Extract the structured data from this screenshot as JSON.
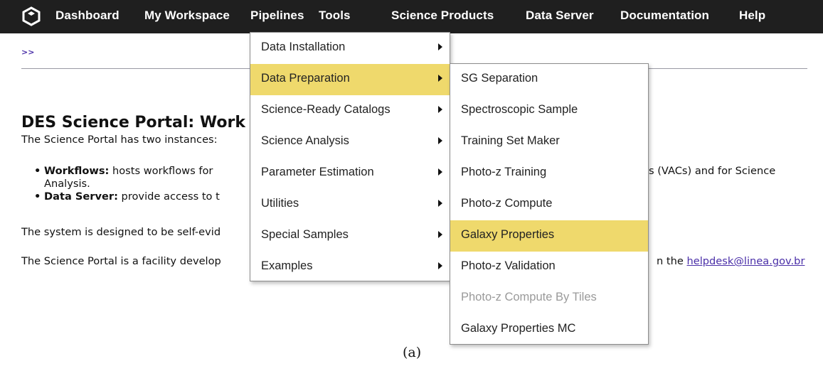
{
  "navbar": {
    "items": [
      "Dashboard",
      "My Workspace",
      "Pipelines",
      "Tools",
      "Science Products",
      "Data Server",
      "Documentation",
      "Help"
    ]
  },
  "breadcrumb": ">>",
  "page": {
    "title": "DES Science Portal: Work",
    "intro": "The Science Portal has two instances:",
    "bullet1_label": "Workflows:",
    "bullet1_text": " hosts workflows for",
    "bullet1_right": "s (VACs) and for Science",
    "bullet1_cont": "Analysis.",
    "bullet2_label": "Data Server:",
    "bullet2_text": " provide access to t",
    "system_line": "The system is designed to be self-evid",
    "facility_line": "The Science Portal is a facility develop",
    "contact_prefix": "n the ",
    "contact_email": "helpdesk@linea.gov.br"
  },
  "pipelines_menu": {
    "items": [
      "Data Installation",
      "Data Preparation",
      "Science-Ready Catalogs",
      "Science Analysis",
      "Parameter Estimation",
      "Utilities",
      "Special Samples",
      "Examples"
    ],
    "highlighted": "Data Preparation"
  },
  "data_prep_menu": {
    "items": [
      "SG Separation",
      "Spectroscopic Sample",
      "Training Set Maker",
      "Photo-z Training",
      "Photo-z Compute",
      "Galaxy Properties",
      "Photo-z Validation",
      "Photo-z Compute By Tiles",
      "Galaxy Properties MC"
    ],
    "highlighted": "Galaxy Properties",
    "disabled": "Photo-z Compute By Tiles"
  },
  "caption": "(a)",
  "colors": {
    "navbar": "#1f1f1f",
    "highlight": "#efd96c",
    "link": "#4a2fa8"
  },
  "icons": {
    "logo": "portal-logo-icon",
    "submenu": "triangle-right-icon"
  }
}
